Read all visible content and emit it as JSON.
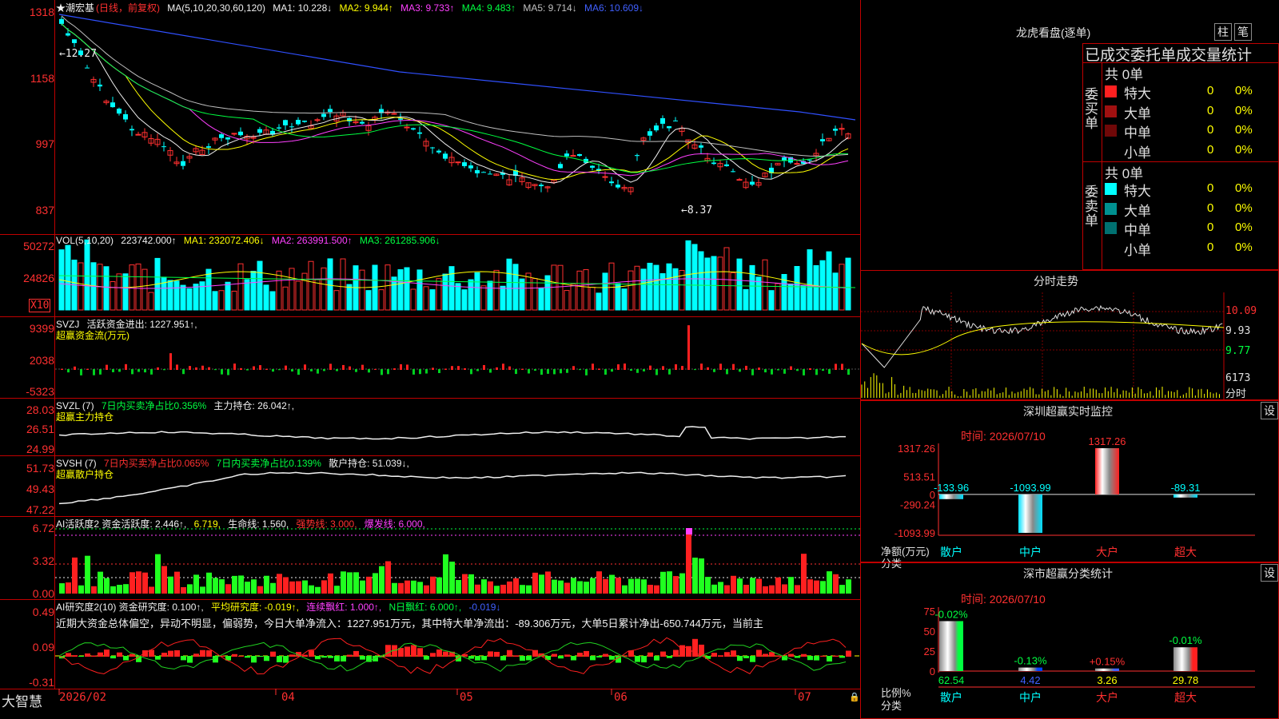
{
  "kline": {
    "stock_name": "★潮宏基",
    "period_label": "(日线，前复权)",
    "ma_legend": [
      {
        "text": "MA(5,10,20,30,60,120)",
        "color": "#f0f0f0"
      },
      {
        "text": "MA1: 10.228↓",
        "color": "#f0f0f0"
      },
      {
        "text": "MA2: 9.944↑",
        "color": "#ffff00"
      },
      {
        "text": "MA3: 9.733↑",
        "color": "#ff40ff"
      },
      {
        "text": "MA4: 9.483↑",
        "color": "#00ff40"
      },
      {
        "text": "MA5: 9.714↓",
        "color": "#c0c0c0"
      },
      {
        "text": "MA6: 10.609↓",
        "color": "#4060ff"
      }
    ],
    "y_ticks": [
      "1318",
      "1158",
      "997",
      "837"
    ],
    "high_marker": "←12.27",
    "low_marker": "←8.37"
  },
  "vol": {
    "legend": [
      {
        "text": "VOL(5,10,20)",
        "color": "#f0f0f0"
      },
      {
        "text": "223742.000↑",
        "color": "#f0f0f0"
      },
      {
        "text": "MA1: 232072.406↓",
        "color": "#ffff00"
      },
      {
        "text": "MA2: 263991.500↑",
        "color": "#ff40ff"
      },
      {
        "text": "MA3: 261285.906↓",
        "color": "#00ff40"
      }
    ],
    "y_ticks": [
      "50272",
      "24826"
    ],
    "unit_box": "X10"
  },
  "svzj": {
    "legend1": [
      {
        "text": "SVZJ",
        "color": "#f0f0f0"
      },
      {
        "text": "活跃资金进出: 1227.951↑,",
        "color": "#f0f0f0"
      }
    ],
    "legend2": "超赢资金流(万元)",
    "y_ticks": [
      "9399",
      "2038",
      "-5323"
    ]
  },
  "svzl": {
    "legend1": [
      {
        "text": "SVZL (7)",
        "color": "#f0f0f0"
      },
      {
        "text": "7日内买卖净占比0.356%",
        "color": "#00ff40"
      },
      {
        "text": "主力持仓: 26.042↑,",
        "color": "#f0f0f0"
      }
    ],
    "legend2": "超赢主力持仓",
    "y_ticks": [
      "28.03",
      "26.51",
      "24.99"
    ]
  },
  "svsh": {
    "legend1": [
      {
        "text": "SVSH (7)",
        "color": "#f0f0f0"
      },
      {
        "text": "7日内买卖净占比0.065%",
        "color": "#ff3030"
      },
      {
        "text": "7日内买卖净占比0.139%",
        "color": "#00ff40"
      },
      {
        "text": "散户持仓: 51.039↓,",
        "color": "#f0f0f0"
      }
    ],
    "legend2": "超赢散户持仓",
    "y_ticks": [
      "51.73",
      "49.43",
      "47.22"
    ]
  },
  "ai_active": {
    "legend": [
      {
        "text": "AI活跃度2 资金活跃度: 2.446↑,",
        "color": "#f0f0f0"
      },
      {
        "text": "6.719,",
        "color": "#ffff00"
      },
      {
        "text": "生命线: 1.560,",
        "color": "#f0f0f0"
      },
      {
        "text": "强势线: 3.000,",
        "color": "#ff3030"
      },
      {
        "text": "爆发线: 6.000,",
        "color": "#ff40ff"
      }
    ],
    "y_ticks": [
      "6.72",
      "3.32",
      "0.00"
    ]
  },
  "ai_research": {
    "legend": [
      {
        "text": "AI研究度2(10) 资金研究度: 0.100↑,",
        "color": "#f0f0f0"
      },
      {
        "text": "平均研究度: -0.019↑,",
        "color": "#ffff00"
      },
      {
        "text": "连续飘红: 1.000↑,",
        "color": "#ff40ff"
      },
      {
        "text": "N日飘红: 6.000↑,",
        "color": "#00ff40"
      },
      {
        "text": "-0.019↓",
        "color": "#4060ff"
      }
    ],
    "comment": "近期大资金总体偏空，异动不明显，偏弱势，今日大单净流入：1227.951万元，其中特大单净流出：-89.306万元，大单5日累计净出-650.744万元，当前主",
    "y_ticks": [
      "0.49",
      "0.09",
      "-0.31"
    ]
  },
  "x_axis": {
    "logo": "大智慧",
    "labels": [
      "2026/02",
      "04",
      "05",
      "06",
      "07"
    ]
  },
  "orderbook": {
    "title": "龙虎看盘(逐单)",
    "btn_bar": "柱",
    "btn_pen": "笔",
    "stats_title": "已成交委托单成交量统计",
    "buy": {
      "side_label": "委买单",
      "total": "共 0单",
      "rows": [
        {
          "label": "特大",
          "count": "0",
          "pct": "0%",
          "color": "#ff2020"
        },
        {
          "label": "大单",
          "count": "0",
          "pct": "0%",
          "color": "#a01010"
        },
        {
          "label": "中单",
          "count": "0",
          "pct": "0%",
          "color": "#700808"
        },
        {
          "label": "小单",
          "count": "0",
          "pct": "0%",
          "color": "#000000"
        }
      ]
    },
    "sell": {
      "side_label": "委卖单",
      "total": "共 0单",
      "rows": [
        {
          "label": "特大",
          "count": "0",
          "pct": "0%",
          "color": "#00ffff"
        },
        {
          "label": "大单",
          "count": "0",
          "pct": "0%",
          "color": "#009090"
        },
        {
          "label": "中单",
          "count": "0",
          "pct": "0%",
          "color": "#007070"
        },
        {
          "label": "小单",
          "count": "0",
          "pct": "0%",
          "color": "#000000"
        }
      ]
    }
  },
  "intraday": {
    "title": "分时走势",
    "price_ticks": [
      "10.09",
      "9.93",
      "9.77"
    ],
    "vol_tick": "6173",
    "vol_label": "分时"
  },
  "monitor": {
    "title": "深圳超赢实时监控",
    "settings": "设",
    "date": "时间: 2026/07/10",
    "y_ticks": [
      "1317.26",
      "513.51",
      "0",
      "-290.24",
      "-1093.99"
    ],
    "unit_label": "净额(万元)",
    "cat_label": "分类",
    "chart_data": {
      "type": "bar",
      "categories": [
        "散户",
        "中户",
        "大户",
        "超大"
      ],
      "values": [
        -133.96,
        -1093.99,
        1317.26,
        -89.31
      ],
      "value_labels": [
        "-133.96",
        "-1093.99",
        "1317.26",
        "-89.31"
      ],
      "ylim": [
        -1093.99,
        1317.26
      ]
    }
  },
  "classify": {
    "title": "深市超赢分类统计",
    "settings": "设",
    "date": "时间: 2026/07/10",
    "y_ticks": [
      "75",
      "50",
      "25",
      "0"
    ],
    "unit_label": "比例%",
    "cat_label": "分类",
    "chart_data": {
      "type": "bar",
      "categories": [
        "散户",
        "中户",
        "大户",
        "超大"
      ],
      "values": [
        62.54,
        4.42,
        3.26,
        29.78
      ],
      "value_labels": [
        "62.54",
        "4.42",
        "3.26",
        "29.78"
      ],
      "change_labels": [
        "-0.02%",
        "-0.13%",
        "+0.15%",
        "-0.01%"
      ],
      "ylim": [
        0,
        75
      ]
    }
  }
}
